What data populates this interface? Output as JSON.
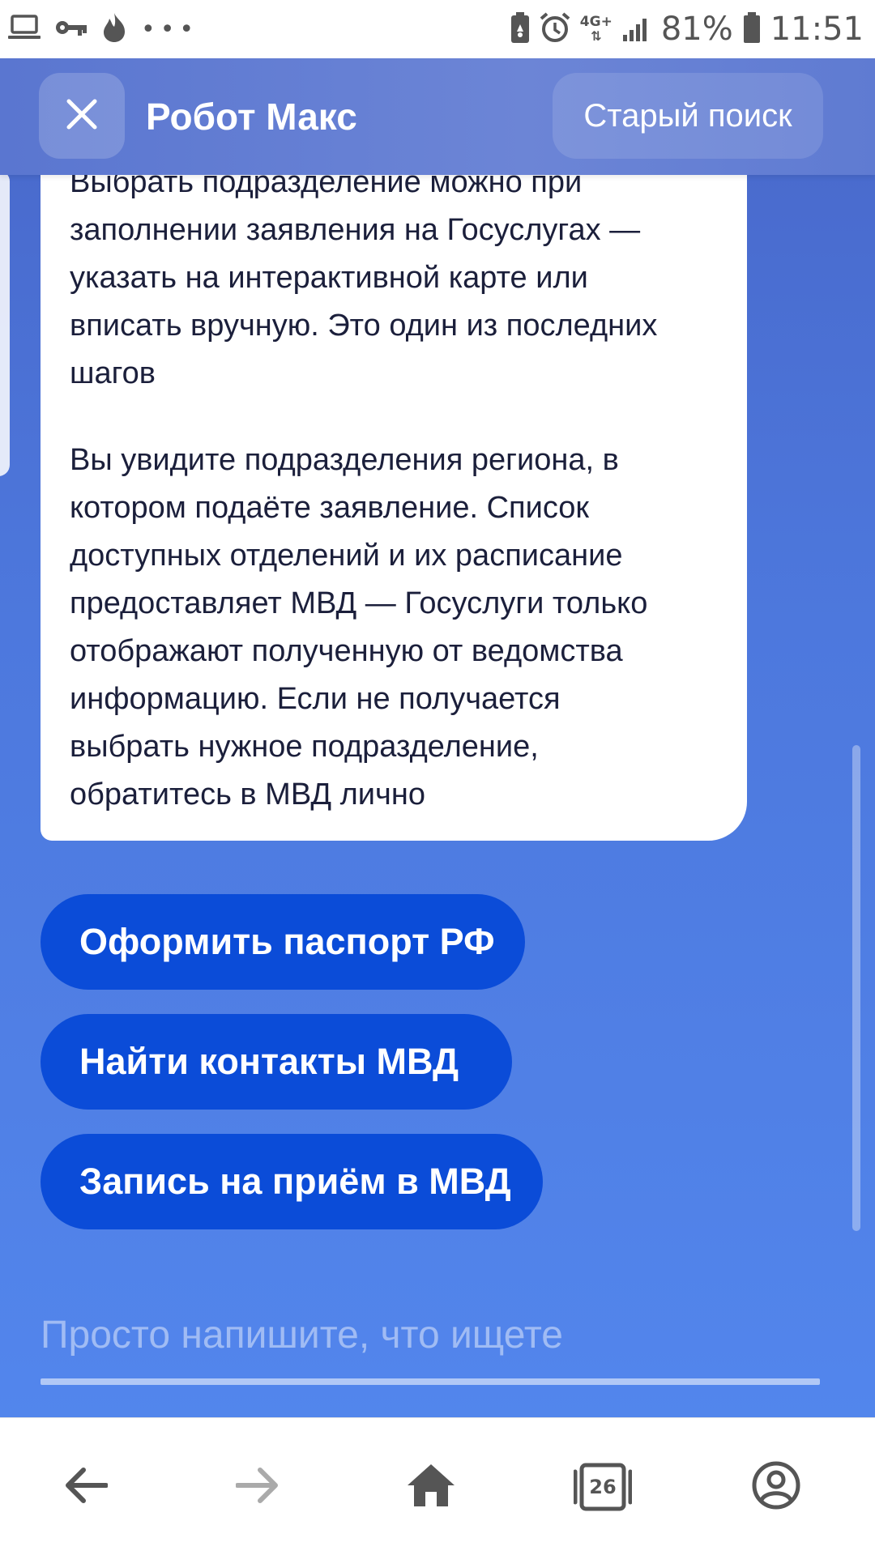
{
  "status_bar": {
    "network_type": "4G+",
    "battery": "81%",
    "time": "11:51",
    "more_dots": "•••",
    "left_icons": [
      "laptop-icon",
      "key-icon",
      "flame-icon"
    ],
    "right_icons": [
      "battery-saver-icon",
      "alarm-icon",
      "signal-icon",
      "battery-icon"
    ]
  },
  "header": {
    "title": "Робот Макс",
    "old_search_label": "Старый поиск",
    "close_icon": "close-icon"
  },
  "message": {
    "paragraph_1_lines": [
      "Выбрать подразделение можно при",
      "заполнении заявления на Госуслугах —",
      "указать на интерактивной карте или",
      "вписать вручную. Это один из последних",
      "шагов"
    ],
    "paragraph_2_lines": [
      "Вы увидите подразделения региона, в",
      "котором подаёте заявление. Список",
      "доступных отделений и их расписание",
      "предоставляет МВД — Госуслуги только",
      "отображают полученную от ведомства",
      "информацию. Если не получается",
      "выбрать нужное подразделение,",
      "обратитесь в МВД лично"
    ]
  },
  "quick_replies": [
    {
      "label": "Оформить паспорт РФ"
    },
    {
      "label": "Найти контакты МВД"
    },
    {
      "label": "Запись на приём в МВД"
    }
  ],
  "input": {
    "placeholder": "Просто напишите, что ищете",
    "value": ""
  },
  "bottom_nav": {
    "tabs_count": "26",
    "icons": [
      "back-arrow-icon",
      "forward-arrow-icon",
      "home-icon",
      "tabs-icon",
      "account-icon"
    ]
  },
  "colors": {
    "accent": "#0b4cd8",
    "background_top": "#4866c8",
    "background_bottom": "#5388ef",
    "text_dark": "#1b1f3b"
  }
}
